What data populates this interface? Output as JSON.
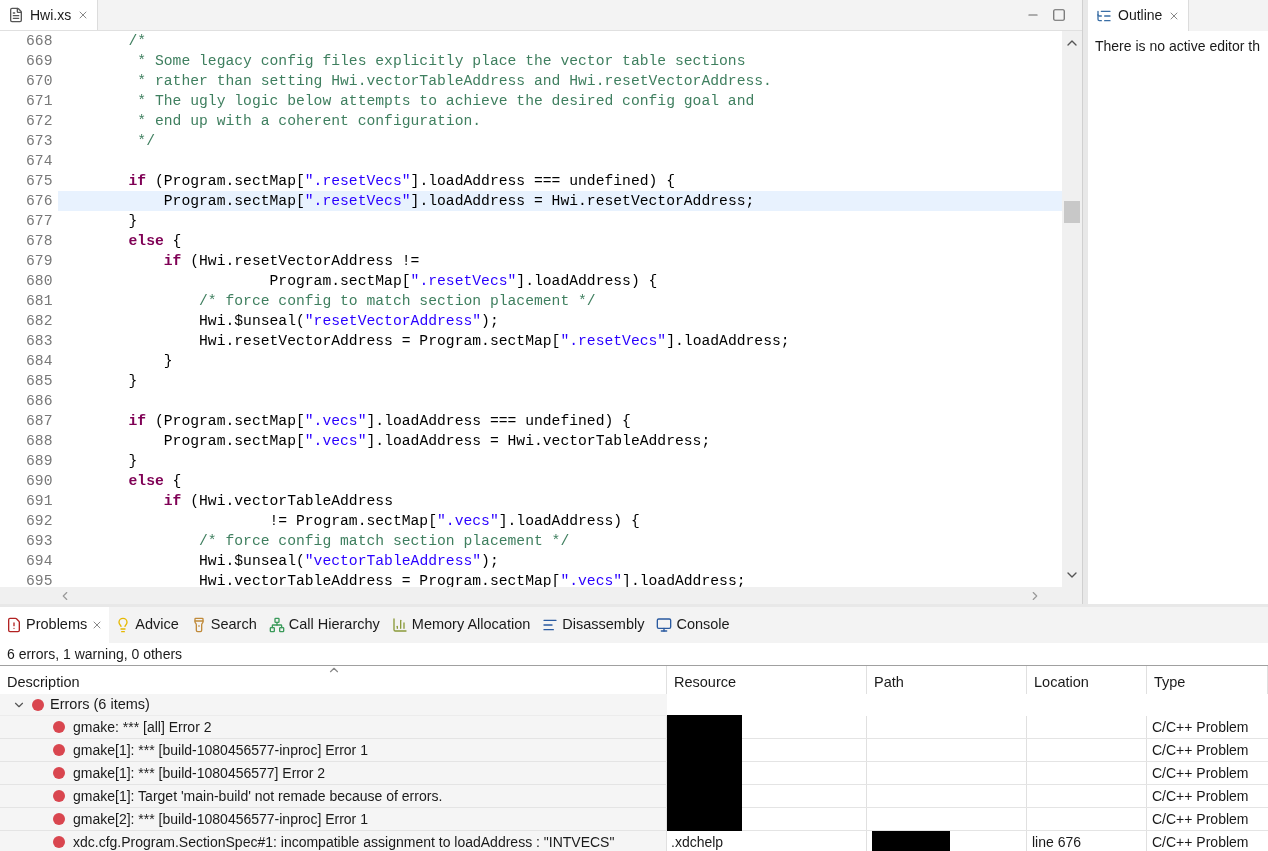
{
  "editor": {
    "tab": {
      "title": "Hwi.xs",
      "selected": true
    },
    "lines": [
      {
        "number": "668",
        "selected": false,
        "tokens": [
          {
            "kind": "comment",
            "text": "        /*"
          }
        ]
      },
      {
        "number": "669",
        "selected": false,
        "tokens": [
          {
            "kind": "comment",
            "text": "         * Some legacy config files explicitly place the vector table sections"
          }
        ]
      },
      {
        "number": "670",
        "selected": false,
        "tokens": [
          {
            "kind": "comment",
            "text": "         * rather than setting Hwi.vectorTableAddress and Hwi.resetVectorAddress."
          }
        ]
      },
      {
        "number": "671",
        "selected": false,
        "tokens": [
          {
            "kind": "comment",
            "text": "         * The ugly logic below attempts to achieve the desired config goal and"
          }
        ]
      },
      {
        "number": "672",
        "selected": false,
        "tokens": [
          {
            "kind": "comment",
            "text": "         * end up with a coherent configuration."
          }
        ]
      },
      {
        "number": "673",
        "selected": false,
        "tokens": [
          {
            "kind": "comment",
            "text": "         */"
          }
        ]
      },
      {
        "number": "674",
        "selected": false
      },
      {
        "number": "675",
        "selected": false,
        "tokens": [
          {
            "kind": "keyword",
            "text": "        if"
          },
          {
            "kind": "plain",
            "text": " (Program.sectMap["
          },
          {
            "kind": "string",
            "text": "\".resetVecs\""
          },
          {
            "kind": "plain",
            "text": "].loadAddress === undefined) {"
          }
        ]
      },
      {
        "number": "676",
        "selected": true,
        "tokens": [
          {
            "kind": "plain",
            "text": "            Program.sectMap["
          },
          {
            "kind": "string",
            "text": "\".resetVecs\""
          },
          {
            "kind": "plain",
            "text": "].loadAddress = Hwi.resetVectorAddress;"
          }
        ]
      },
      {
        "number": "677",
        "selected": false,
        "tokens": [
          {
            "kind": "plain",
            "text": "        }"
          }
        ]
      },
      {
        "number": "678",
        "selected": false,
        "tokens": [
          {
            "kind": "keyword",
            "text": "        else"
          },
          {
            "kind": "plain",
            "text": " {"
          }
        ]
      },
      {
        "number": "679",
        "selected": false,
        "tokens": [
          {
            "kind": "keyword",
            "text": "            if"
          },
          {
            "kind": "plain",
            "text": " (Hwi.resetVectorAddress !="
          }
        ]
      },
      {
        "number": "680",
        "selected": false,
        "tokens": [
          {
            "kind": "plain",
            "text": "                        Program.sectMap["
          },
          {
            "kind": "string",
            "text": "\".resetVecs\""
          },
          {
            "kind": "plain",
            "text": "].loadAddress) {"
          }
        ]
      },
      {
        "number": "681",
        "selected": false,
        "tokens": [
          {
            "kind": "comment",
            "text": "                /* force config to match section placement */"
          }
        ]
      },
      {
        "number": "682",
        "selected": false,
        "tokens": [
          {
            "kind": "plain",
            "text": "                Hwi.$unseal("
          },
          {
            "kind": "string",
            "text": "\"resetVectorAddress\""
          },
          {
            "kind": "plain",
            "text": ");"
          }
        ]
      },
      {
        "number": "683",
        "selected": false,
        "tokens": [
          {
            "kind": "plain",
            "text": "                Hwi.resetVectorAddress = Program.sectMap["
          },
          {
            "kind": "string",
            "text": "\".resetVecs\""
          },
          {
            "kind": "plain",
            "text": "].loadAddress;"
          }
        ]
      },
      {
        "number": "684",
        "selected": false,
        "tokens": [
          {
            "kind": "plain",
            "text": "            }"
          }
        ]
      },
      {
        "number": "685",
        "selected": false,
        "tokens": [
          {
            "kind": "plain",
            "text": "        }"
          }
        ]
      },
      {
        "number": "686",
        "selected": false
      },
      {
        "number": "687",
        "selected": false,
        "tokens": [
          {
            "kind": "keyword",
            "text": "        if"
          },
          {
            "kind": "plain",
            "text": " (Program.sectMap["
          },
          {
            "kind": "string",
            "text": "\".vecs\""
          },
          {
            "kind": "plain",
            "text": "].loadAddress === undefined) {"
          }
        ]
      },
      {
        "number": "688",
        "selected": false,
        "tokens": [
          {
            "kind": "plain",
            "text": "            Program.sectMap["
          },
          {
            "kind": "string",
            "text": "\".vecs\""
          },
          {
            "kind": "plain",
            "text": "].loadAddress = Hwi.vectorTableAddress;"
          }
        ]
      },
      {
        "number": "689",
        "selected": false,
        "tokens": [
          {
            "kind": "plain",
            "text": "        }"
          }
        ]
      },
      {
        "number": "690",
        "selected": false,
        "tokens": [
          {
            "kind": "keyword",
            "text": "        else"
          },
          {
            "kind": "plain",
            "text": " {"
          }
        ]
      },
      {
        "number": "691",
        "selected": false,
        "tokens": [
          {
            "kind": "keyword",
            "text": "            if"
          },
          {
            "kind": "plain",
            "text": " (Hwi.vectorTableAddress"
          }
        ]
      },
      {
        "number": "692",
        "selected": false,
        "tokens": [
          {
            "kind": "plain",
            "text": "                        != Program.sectMap["
          },
          {
            "kind": "string",
            "text": "\".vecs\""
          },
          {
            "kind": "plain",
            "text": "].loadAddress) {"
          }
        ]
      },
      {
        "number": "693",
        "selected": false,
        "tokens": [
          {
            "kind": "comment",
            "text": "                /* force config match section placement */"
          }
        ]
      },
      {
        "number": "694",
        "selected": false,
        "tokens": [
          {
            "kind": "plain",
            "text": "                Hwi.$unseal("
          },
          {
            "kind": "string",
            "text": "\"vectorTableAddress\""
          },
          {
            "kind": "plain",
            "text": ");"
          }
        ]
      },
      {
        "number": "695",
        "selected": false,
        "tokens": [
          {
            "kind": "plain",
            "text": "                Hwi.vectorTableAddress = Program.sectMap["
          },
          {
            "kind": "string",
            "text": "\".vecs\""
          },
          {
            "kind": "plain",
            "text": "].loadAddress;"
          }
        ]
      }
    ]
  },
  "outline": {
    "tab": {
      "title": "Outline",
      "selected": true
    },
    "message": "There is no active editor th"
  },
  "bottom_panel": {
    "tabs": [
      {
        "label": "Problems",
        "selected": true
      },
      {
        "label": "Advice",
        "selected": false
      },
      {
        "label": "Search",
        "selected": false
      },
      {
        "label": "Call Hierarchy",
        "selected": false
      },
      {
        "label": "Memory Allocation",
        "selected": false
      },
      {
        "label": "Disassembly",
        "selected": false
      },
      {
        "label": "Console",
        "selected": false
      }
    ],
    "summary": "6 errors, 1 warning, 0 others",
    "table": {
      "columns": [
        "Description",
        "Resource",
        "Path",
        "Location",
        "Type"
      ],
      "groups": [
        {
          "label": "Errors (6 items)",
          "expanded": true,
          "rows": [
            {
              "description": "gmake: *** [all] Error 2",
              "resource_redacted": true,
              "type": "C/C++ Problem"
            },
            {
              "description": "gmake[1]: *** [build-1080456577-inproc] Error 1",
              "resource_redacted": true,
              "type": "C/C++ Problem"
            },
            {
              "description": "gmake[1]: *** [build-1080456577] Error 2",
              "resource_redacted": true,
              "type": "C/C++ Problem"
            },
            {
              "description": "gmake[1]: Target 'main-build' not remade because of errors.",
              "resource_redacted": true,
              "type": "C/C++ Problem"
            },
            {
              "description": "gmake[2]: *** [build-1080456577-inproc] Error 1",
              "resource_redacted": true,
              "type": "C/C++ Problem"
            },
            {
              "description": "xdc.cfg.Program.SectionSpec#1: incompatible assignment to loadAddress : \"INTVECS\"",
              "resource": ".xdchelp",
              "path_redacted": true,
              "location": "line 676",
              "type": "C/C++ Problem"
            }
          ]
        }
      ]
    }
  }
}
